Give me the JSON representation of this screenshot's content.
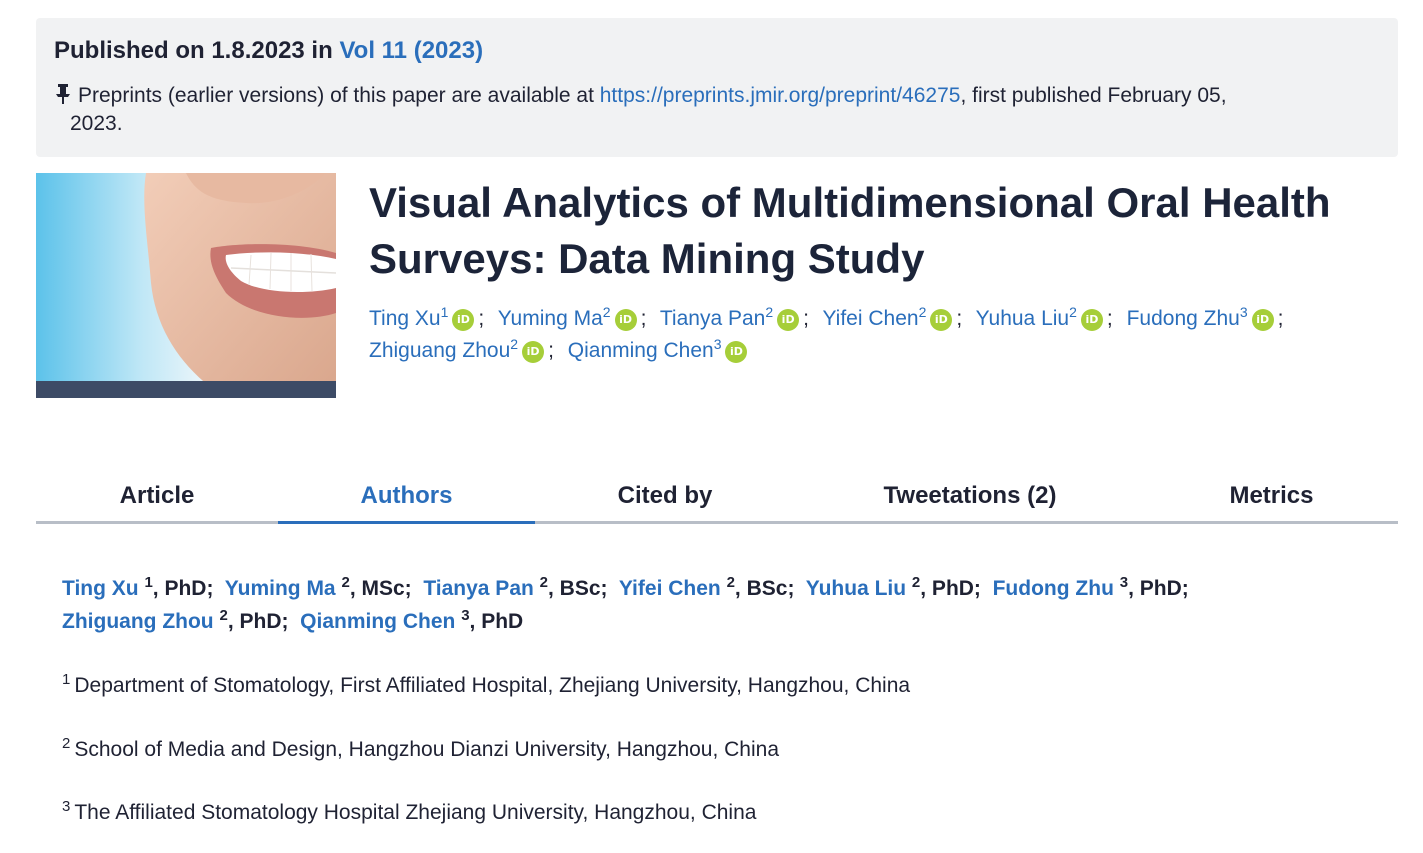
{
  "publication": {
    "published_prefix": "Published on 1.8.2023 in",
    "volume_link": "Vol 11 (2023)",
    "preprint_text": "Preprints (earlier versions) of this paper are available at",
    "preprint_url": "https://preprints.jmir.org/preprint/46275",
    "preprint_suffix": ", first published February 05,",
    "preprint_year": "2023."
  },
  "title": "Visual Analytics of Multidimensional Oral Health Surveys: Data Mining Study",
  "authors_top": [
    {
      "name": "Ting Xu",
      "aff": "1"
    },
    {
      "name": "Yuming Ma",
      "aff": "2"
    },
    {
      "name": "Tianya Pan",
      "aff": "2"
    },
    {
      "name": "Yifei Chen",
      "aff": "2"
    },
    {
      "name": "Yuhua Liu",
      "aff": "2"
    },
    {
      "name": "Fudong Zhu",
      "aff": "3"
    },
    {
      "name": "Zhiguang Zhou",
      "aff": "2"
    },
    {
      "name": "Qianming Chen",
      "aff": "3"
    }
  ],
  "orcid_label": "iD",
  "separator": ";",
  "tabs": [
    {
      "label": "Article"
    },
    {
      "label": "Authors"
    },
    {
      "label": "Cited by"
    },
    {
      "label": "Tweetations (2)"
    },
    {
      "label": "Metrics"
    }
  ],
  "active_tab": "Authors",
  "authors_detail": [
    {
      "name": "Ting Xu",
      "aff": "1",
      "degree": ", PhD;"
    },
    {
      "name": "Yuming Ma",
      "aff": "2",
      "degree": ", MSc;"
    },
    {
      "name": "Tianya Pan",
      "aff": "2",
      "degree": ", BSc;"
    },
    {
      "name": "Yifei Chen",
      "aff": "2",
      "degree": ", BSc;"
    },
    {
      "name": "Yuhua Liu",
      "aff": "2",
      "degree": ", PhD;"
    },
    {
      "name": "Fudong Zhu",
      "aff": "3",
      "degree": ", PhD;"
    },
    {
      "name": "Zhiguang Zhou",
      "aff": "2",
      "degree": ", PhD;"
    },
    {
      "name": "Qianming Chen",
      "aff": "3",
      "degree": ", PhD"
    }
  ],
  "affiliations": [
    {
      "num": "1",
      "text": "Department of Stomatology, First Affiliated Hospital, Zhejiang University, Hangzhou, China"
    },
    {
      "num": "2",
      "text": "School of Media and Design, Hangzhou Dianzi University, Hangzhou, China"
    },
    {
      "num": "3",
      "text": "The Affiliated Stomatology Hospital Zhejiang University, Hangzhou, China"
    }
  ],
  "colors": {
    "link": "#2a6ebb",
    "orcid": "#a6ce39",
    "panel": "#f1f2f3"
  }
}
